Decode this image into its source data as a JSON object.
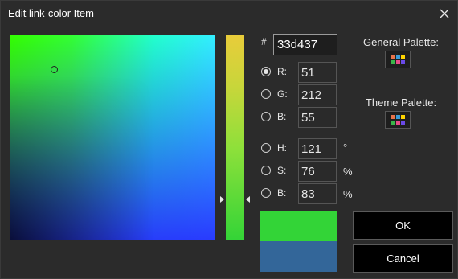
{
  "window": {
    "title": "Edit link-color Item"
  },
  "picker": {
    "hex_label": "#",
    "hex_value": "33d437",
    "rgb": [
      {
        "label": "R:",
        "value": "51",
        "selected": true
      },
      {
        "label": "G:",
        "value": "212",
        "selected": false
      },
      {
        "label": "B:",
        "value": "55",
        "selected": false
      }
    ],
    "hsb": [
      {
        "label": "H:",
        "value": "121",
        "unit": "°"
      },
      {
        "label": "S:",
        "value": "76",
        "unit": "%"
      },
      {
        "label": "B:",
        "value": "83",
        "unit": "%"
      }
    ],
    "new_color": "#33d437",
    "old_color": "#336699"
  },
  "palettes": {
    "general_label": "General Palette:",
    "theme_label": "Theme Palette:",
    "swatch_colors": [
      "#e8734a",
      "#3a9bd6",
      "#ffd400",
      "#3ab54a",
      "#e84a8a",
      "#6a4ae8"
    ]
  },
  "buttons": {
    "ok": "OK",
    "cancel": "Cancel"
  }
}
